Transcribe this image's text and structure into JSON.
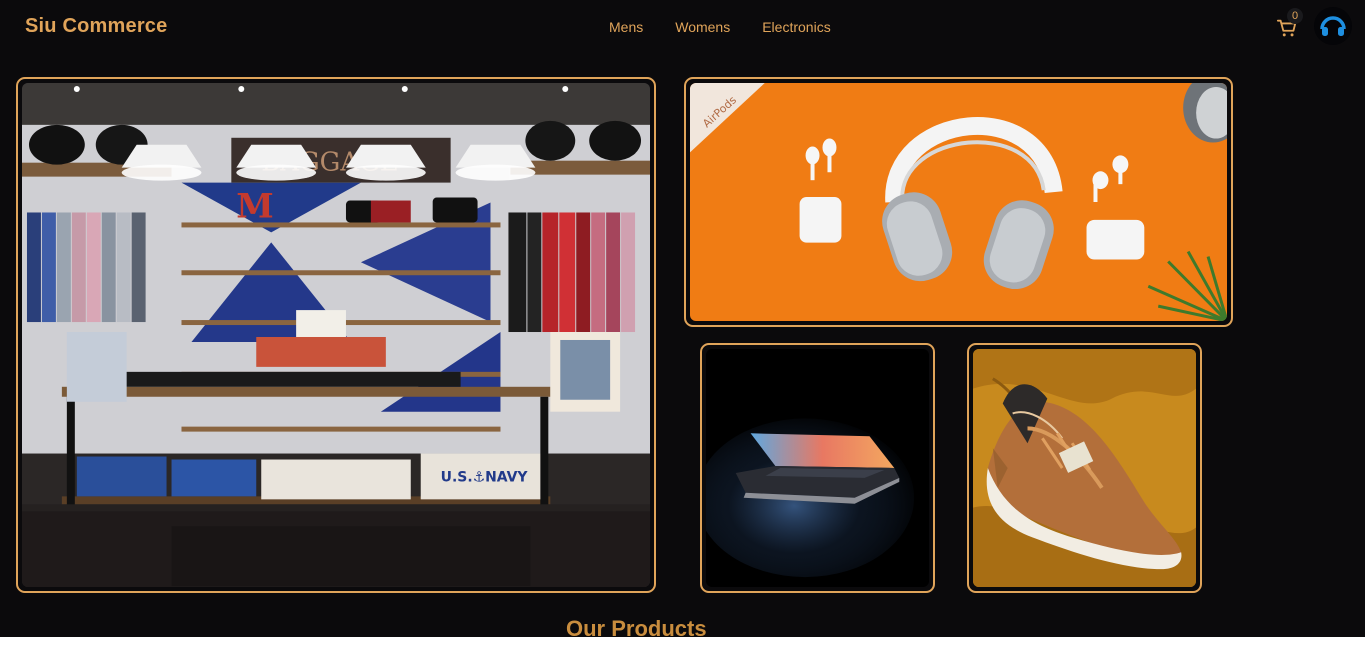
{
  "header": {
    "brand": "Siu Commerce",
    "nav": [
      {
        "label": "Mens"
      },
      {
        "label": "Womens"
      },
      {
        "label": "Electronics"
      }
    ],
    "cart_count": "0",
    "cart_icon": "shopping-cart-icon",
    "avatar_icon": "user-avatar-icon"
  },
  "hero": {
    "tiles": [
      {
        "name": "store-interior",
        "image": "clothing store interior"
      },
      {
        "name": "headphones",
        "image": "headphones and earbuds on orange"
      },
      {
        "name": "laptop",
        "image": "laptop glowing in the dark"
      },
      {
        "name": "sneaker",
        "image": "brown sneaker on mustard fabric"
      }
    ]
  },
  "products": {
    "title": "Our Products"
  },
  "colors": {
    "background": "#0b0a0c",
    "accent": "#e0a45a"
  }
}
